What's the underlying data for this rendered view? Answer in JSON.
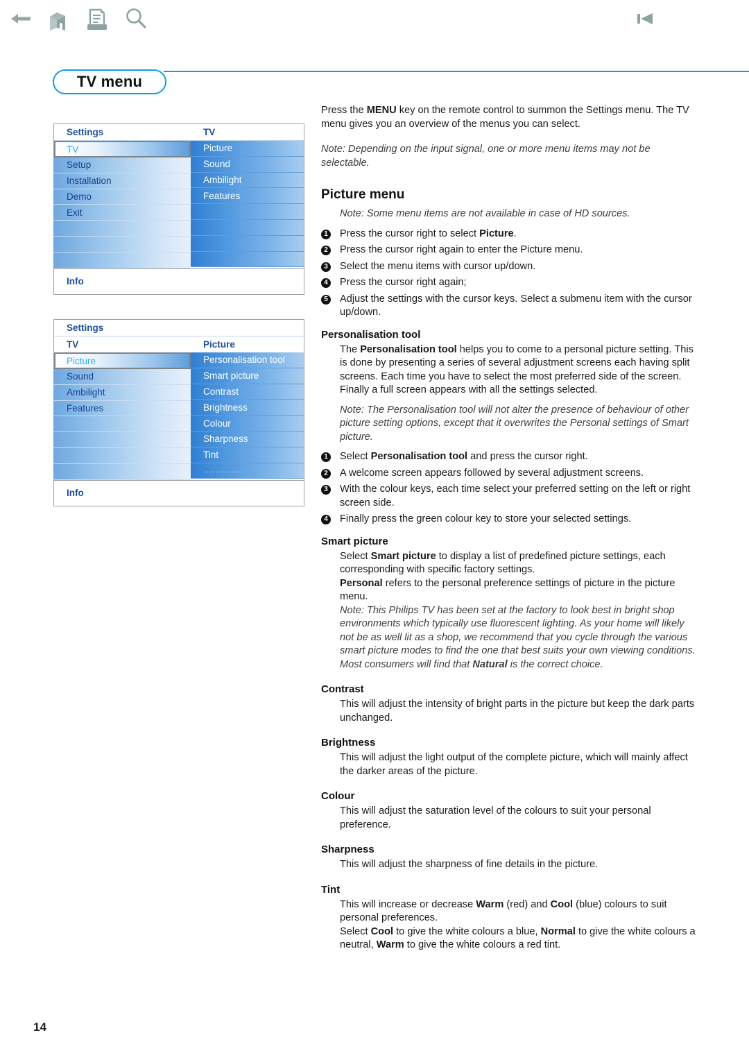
{
  "toolbar": {
    "back_label": "back-arrow",
    "home_label": "home",
    "print_label": "print",
    "search_label": "search",
    "prev_label": "previous"
  },
  "page": {
    "title": "TV menu",
    "number": "14"
  },
  "osd_menus": [
    {
      "name": "tv-menu-screen",
      "header_left": "Settings",
      "header_right": "TV",
      "subheader_left": "",
      "subheader_right": "",
      "left_items": [
        "TV",
        "Setup",
        "Installation",
        "Demo",
        "Exit",
        "",
        "",
        ""
      ],
      "left_selected_index": 0,
      "right_items": [
        "Picture",
        "Sound",
        "Ambilight",
        "Features",
        "",
        "",
        "",
        ""
      ],
      "footer": "Info"
    },
    {
      "name": "picture-menu-screen",
      "header_full": "Settings",
      "subheader_left": "TV",
      "subheader_right": "Picture",
      "left_items": [
        "Picture",
        "Sound",
        "Ambilight",
        "Features",
        "",
        "",
        "",
        ""
      ],
      "left_selected_index": 0,
      "right_items": [
        "Personalisation tool",
        "Smart picture",
        "Contrast",
        "Brightness",
        "Colour",
        "Sharpness",
        "Tint",
        "............."
      ],
      "footer": "Info"
    }
  ],
  "content": {
    "intro_line1_pre": "Press the ",
    "intro_line1_bold": "MENU",
    "intro_line1_post": " key on the remote control to summon the Settings menu. The TV menu gives you an overview of the menus you can select.",
    "intro_note": "Note: Depending on the input signal, one or more menu items may not be selectable.",
    "picture_menu_heading": "Picture menu",
    "picture_menu_note": "Note: Some menu items are not available in case of HD sources.",
    "picture_steps": [
      {
        "num": "1",
        "pre": "Press the cursor right to select ",
        "bold": "Picture",
        "post": "."
      },
      {
        "num": "2",
        "pre": "Press the cursor right again to enter the Picture menu.",
        "bold": "",
        "post": ""
      },
      {
        "num": "3",
        "pre": "Select the menu items with cursor up/down.",
        "bold": "",
        "post": ""
      },
      {
        "num": "4",
        "pre": "Press the cursor right again;",
        "bold": "",
        "post": ""
      },
      {
        "num": "5",
        "pre": "Adjust the settings with the cursor keys. Select a submenu item with the cursor up/down.",
        "bold": "",
        "post": ""
      }
    ],
    "personalisation": {
      "heading": "Personalisation tool",
      "body_pre": "The ",
      "body_bold": "Personalisation tool",
      "body_post": " helps you to come to a personal picture setting. This is done by presenting a series of several adjustment screens each having split screens. Each time you have to select the most preferred side of the screen. Finally a full screen appears with all the settings selected.",
      "note": "Note: The Personalisation tool will not alter the presence of behaviour of other picture setting options, except that it overwrites the Personal settings of Smart picture.",
      "steps": [
        {
          "num": "1",
          "pre": "Select ",
          "bold": "Personalisation tool",
          "post": " and press the cursor right."
        },
        {
          "num": "2",
          "pre": "A welcome screen appears followed by several adjustment screens.",
          "bold": "",
          "post": ""
        },
        {
          "num": "3",
          "pre": "With the colour keys, each time select your preferred setting on the left or right screen side.",
          "bold": "",
          "post": ""
        },
        {
          "num": "4",
          "pre": "Finally press the green colour key to store your selected settings.",
          "bold": "",
          "post": ""
        }
      ]
    },
    "smart_picture": {
      "heading": "Smart picture",
      "p1_pre": "Select ",
      "p1_bold": "Smart picture",
      "p1_post": " to display a list of predefined picture settings, each corresponding with specific factory settings.",
      "p2_bold": "Personal",
      "p2_post": " refers to the personal preference settings of picture in the picture menu.",
      "note_pre": "Note: This Philips TV has been set at the factory to look best in bright shop environments which typically use fluorescent lighting. As your home will likely not be as well lit as a shop, we recommend that you cycle through the various smart picture modes to find the one that best suits your own viewing conditions. Most consumers will find that ",
      "note_bold": "Natural",
      "note_post": " is the correct choice."
    },
    "contrast": {
      "heading": "Contrast",
      "body": "This will adjust the intensity of bright parts in the picture but keep the dark parts unchanged."
    },
    "brightness": {
      "heading": "Brightness",
      "body": "This will adjust the light output of the complete picture, which will mainly affect the darker areas of the picture."
    },
    "colour": {
      "heading": "Colour",
      "body": "This will adjust the saturation level of the colours to suit your personal preference."
    },
    "sharpness": {
      "heading": "Sharpness",
      "body": "This will adjust the sharpness of fine details in the picture."
    },
    "tint": {
      "heading": "Tint",
      "p1_pre": "This will increase or decrease ",
      "p1_b1": "Warm",
      "p1_mid": " (red) and ",
      "p1_b2": "Cool",
      "p1_post": " (blue) colours to suit personal preferences.",
      "p2_pre": "Select ",
      "p2_b1": "Cool",
      "p2_mid1": " to give the white colours a blue, ",
      "p2_b2": "Normal",
      "p2_mid2": " to give the white colours a neutral, ",
      "p2_b3": "Warm",
      "p2_post": " to give the white colours a red tint."
    }
  },
  "colors": {
    "accent": "#0b9ee8",
    "icon_gray": "#93a7a7",
    "menu_blue": "#2f7fd4",
    "menu_text_blue": "#17428f",
    "selected_text": "#22b7ef"
  }
}
